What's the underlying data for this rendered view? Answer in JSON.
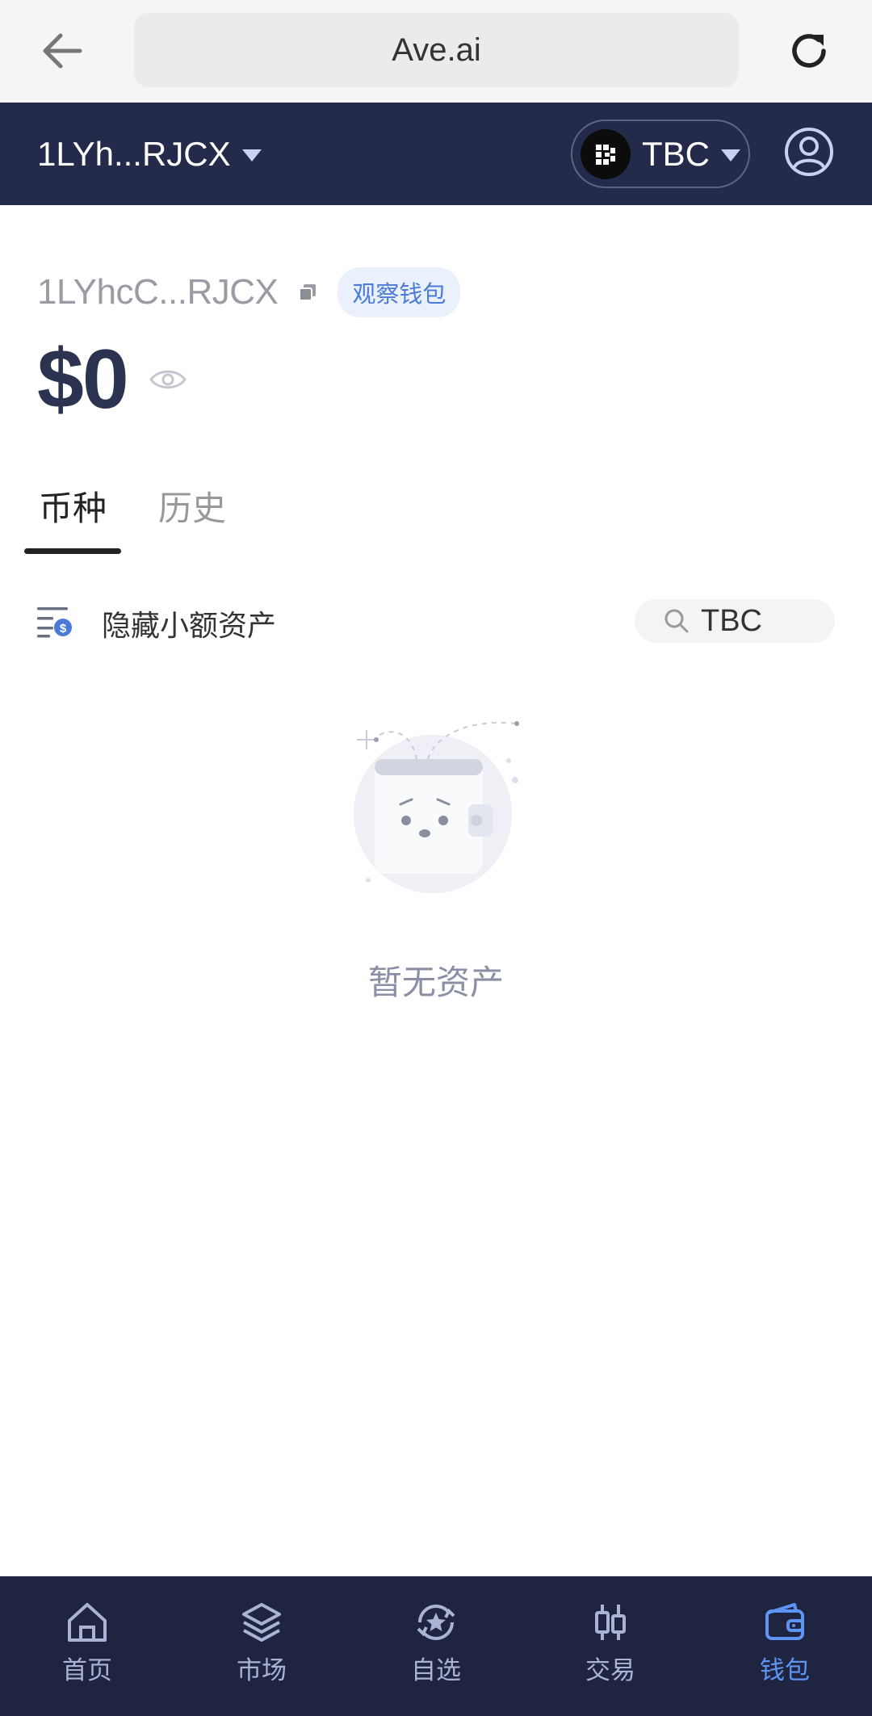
{
  "browser": {
    "url": "Ave.ai"
  },
  "header": {
    "wallet_short": "1LYh...RJCX",
    "chain": "TBC"
  },
  "wallet": {
    "address": "1LYhcC...RJCX",
    "badge": "观察钱包",
    "balance": "$0"
  },
  "tabs": [
    {
      "label": "币种",
      "active": true
    },
    {
      "label": "历史",
      "active": false
    }
  ],
  "filter": {
    "hide_small_label": "隐藏小额资产",
    "search_value": "TBC"
  },
  "empty_state": {
    "text": "暂无资产"
  },
  "bottom_nav": [
    {
      "label": "首页",
      "icon": "home-icon",
      "active": false
    },
    {
      "label": "市场",
      "icon": "layers-icon",
      "active": false
    },
    {
      "label": "自选",
      "icon": "star-refresh-icon",
      "active": false
    },
    {
      "label": "交易",
      "icon": "candlestick-icon",
      "active": false
    },
    {
      "label": "钱包",
      "icon": "wallet-icon",
      "active": true
    }
  ],
  "colors": {
    "header_bg": "#242b4a",
    "nav_bg": "#1f2540",
    "accent": "#5e95f5",
    "badge_bg": "#eaf1fd",
    "badge_text": "#4b7bd9"
  }
}
